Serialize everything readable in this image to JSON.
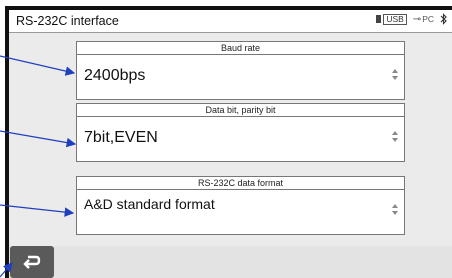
{
  "header": {
    "title": "RS-232C interface",
    "status": {
      "usb_label": "USB",
      "pc_label": "PC",
      "icons": [
        "usb-icon",
        "pc-plug-icon",
        "bluetooth-icon"
      ]
    }
  },
  "fields": [
    {
      "label": "Baud rate",
      "value": "2400bps"
    },
    {
      "label": "Data bit, parity bit",
      "value": "7bit,EVEN"
    },
    {
      "label": "RS-232C data format",
      "value": "A&D standard format"
    }
  ],
  "footer": {
    "back_icon": "return-arrow-icon"
  },
  "colors": {
    "annotation_arrow": "#1f3fbf",
    "back_button": "#5a5a5a"
  }
}
